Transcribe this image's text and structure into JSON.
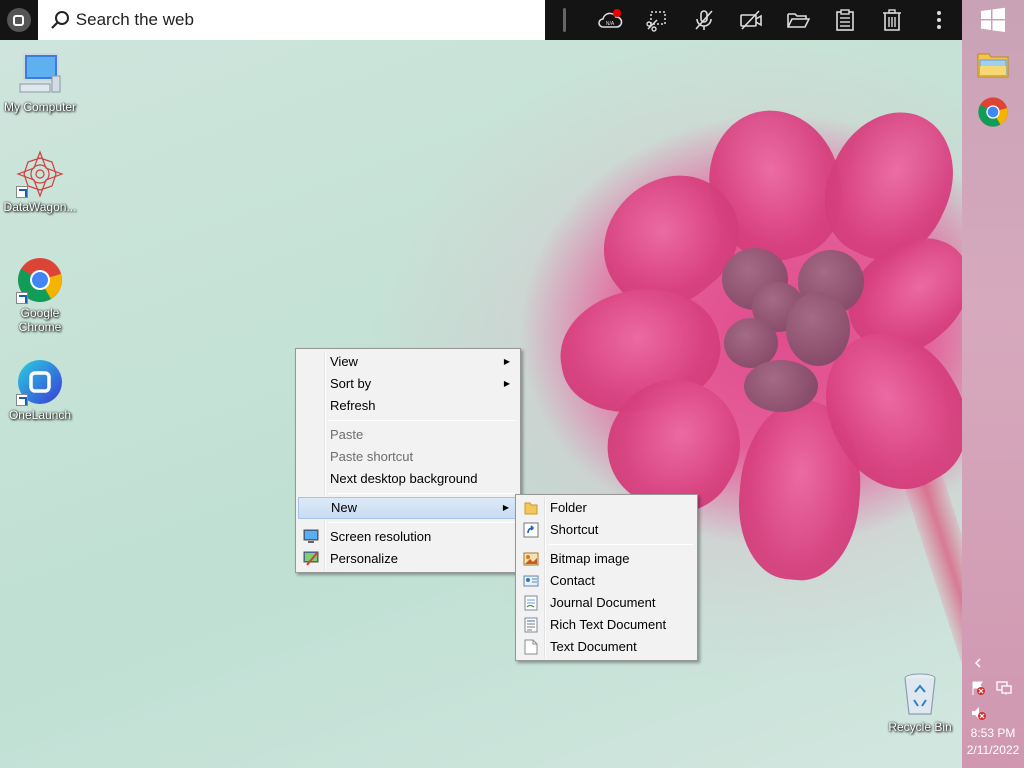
{
  "search": {
    "placeholder": "Search the web"
  },
  "toolbar": {
    "tools": [
      {
        "icon": "cloud-na-icon",
        "badge": "N/A"
      },
      {
        "icon": "screenshot-select-icon"
      },
      {
        "icon": "mic-off-icon"
      },
      {
        "icon": "camera-off-icon"
      },
      {
        "icon": "folder-open-icon"
      },
      {
        "icon": "clipboard-icon"
      },
      {
        "icon": "trash-icon"
      },
      {
        "icon": "more-vertical-icon"
      }
    ]
  },
  "desktop_icons": [
    {
      "label": "My Computer",
      "icon": "computer-icon"
    },
    {
      "label": "DataWagon...",
      "icon": "datawagon-icon"
    },
    {
      "label": "Google Chrome",
      "icon": "chrome-icon"
    },
    {
      "label": "OneLaunch",
      "icon": "onelaunch-icon"
    },
    {
      "label": "Recycle Bin",
      "icon": "recycle-bin-icon"
    }
  ],
  "context_menu": {
    "items": [
      {
        "label": "View",
        "submenu": true,
        "disabled": false
      },
      {
        "label": "Sort by",
        "submenu": true,
        "disabled": false
      },
      {
        "label": "Refresh",
        "submenu": false,
        "disabled": false
      },
      {
        "label": "Paste",
        "submenu": false,
        "disabled": true
      },
      {
        "label": "Paste shortcut",
        "submenu": false,
        "disabled": true
      },
      {
        "label": "Next desktop background",
        "submenu": false,
        "disabled": false
      },
      {
        "label": "New",
        "submenu": true,
        "disabled": false,
        "highlighted": true
      },
      {
        "label": "Screen resolution",
        "icon": "screen-resolution-icon"
      },
      {
        "label": "Personalize",
        "icon": "personalize-icon"
      }
    ]
  },
  "new_submenu": {
    "items": [
      {
        "label": "Folder",
        "icon": "folder-icon"
      },
      {
        "label": "Shortcut",
        "icon": "shortcut-icon"
      },
      {
        "label": "Bitmap image",
        "icon": "bitmap-icon"
      },
      {
        "label": "Contact",
        "icon": "contact-icon"
      },
      {
        "label": "Journal Document",
        "icon": "journal-icon"
      },
      {
        "label": "Rich Text Document",
        "icon": "rich-text-icon"
      },
      {
        "label": "Text Document",
        "icon": "text-document-icon"
      }
    ]
  },
  "tray": {
    "time": "8:53 PM",
    "date": "2/11/2022"
  },
  "colors": {
    "topbar": "#141414",
    "menu_bg": "#f2f2f2",
    "highlight": "#cce0f5",
    "flower": "#e0558f"
  }
}
